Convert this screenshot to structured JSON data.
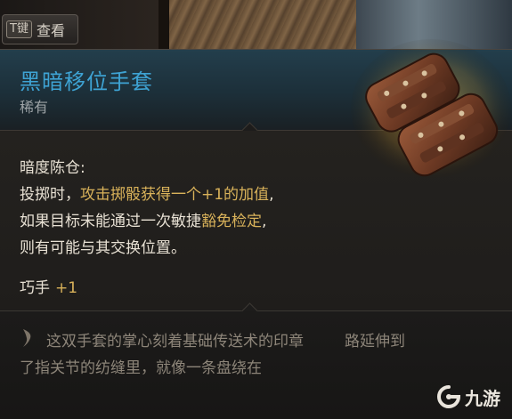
{
  "hint": {
    "key": "T键",
    "label": "查看"
  },
  "item": {
    "name": "黑暗移位手套",
    "rarity": "稀有",
    "name_color": "#3ea3d4",
    "highlight_color": "#d9b25a"
  },
  "ability": {
    "title": "暗度陈仓:",
    "line1_pre": "投掷时，",
    "line1_hl": "攻击掷骰获得一个+1的加值",
    "line1_post": ",",
    "line2_pre": "如果目标未能通过一次敏捷",
    "line2_hl": "豁免检定",
    "line2_post": ",",
    "line3": "则有可能与其交换位置。"
  },
  "stat": {
    "label": "巧手",
    "value": "+1"
  },
  "flavor": {
    "line1": "这双手套的掌心刻着基础传送术的印章",
    "line1_tail": "路延伸到",
    "line2": "了指关节的纺缝里，就像一条盘绕在",
    "icon": "quill-icon"
  },
  "watermark": {
    "text": "九游",
    "icon": "jiuyou-logo-icon"
  }
}
